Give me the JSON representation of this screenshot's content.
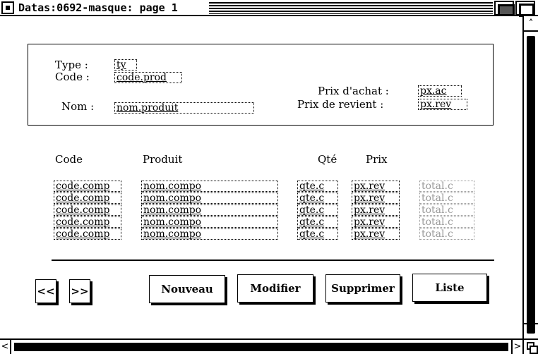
{
  "window": {
    "title": "Datas:0692-masque:  page  1"
  },
  "header": {
    "type_label": "Type :",
    "type_value": "ty",
    "code_label": "Code :",
    "code_value": "code.prod",
    "nom_label": "Nom :",
    "nom_value": "nom.produit",
    "prix_achat_label": "Prix d'achat :",
    "prix_achat_value": "px.ac",
    "prix_revient_label": "Prix de revient :",
    "prix_revient_value": "px.rev"
  },
  "table": {
    "columns": [
      "Code",
      "Produit",
      "Qté",
      "Prix"
    ],
    "rows": [
      {
        "code": "code.comp",
        "produit": "nom.compo",
        "qte": "qte.c",
        "prix": "px.rev",
        "total": "total.c"
      },
      {
        "code": "code.comp",
        "produit": "nom.compo",
        "qte": "qte.c",
        "prix": "px.rev",
        "total": "total.c"
      },
      {
        "code": "code.comp",
        "produit": "nom.compo",
        "qte": "qte.c",
        "prix": "px.rev",
        "total": "total.c"
      },
      {
        "code": "code.comp",
        "produit": "nom.compo",
        "qte": "qte.c",
        "prix": "px.rev",
        "total": "total.c"
      },
      {
        "code": "code.comp",
        "produit": "nom.compo",
        "qte": "qte.c",
        "prix": "px.rev",
        "total": "total.c"
      }
    ]
  },
  "buttons": {
    "prev": "<<",
    "next": ">>",
    "nouveau": "Nouveau",
    "modifier": "Modifier",
    "supprimer": "Supprimer",
    "liste": "Liste"
  },
  "icons": {
    "close": "close-box-icon",
    "zoom": "iconify-icon",
    "full": "fullscreen-icon",
    "scroll_up": "arrow-up-icon",
    "scroll_down": "arrow-down-icon",
    "scroll_left": "arrow-left-icon",
    "scroll_right": "arrow-right-icon",
    "sizer": "resize-icon"
  }
}
